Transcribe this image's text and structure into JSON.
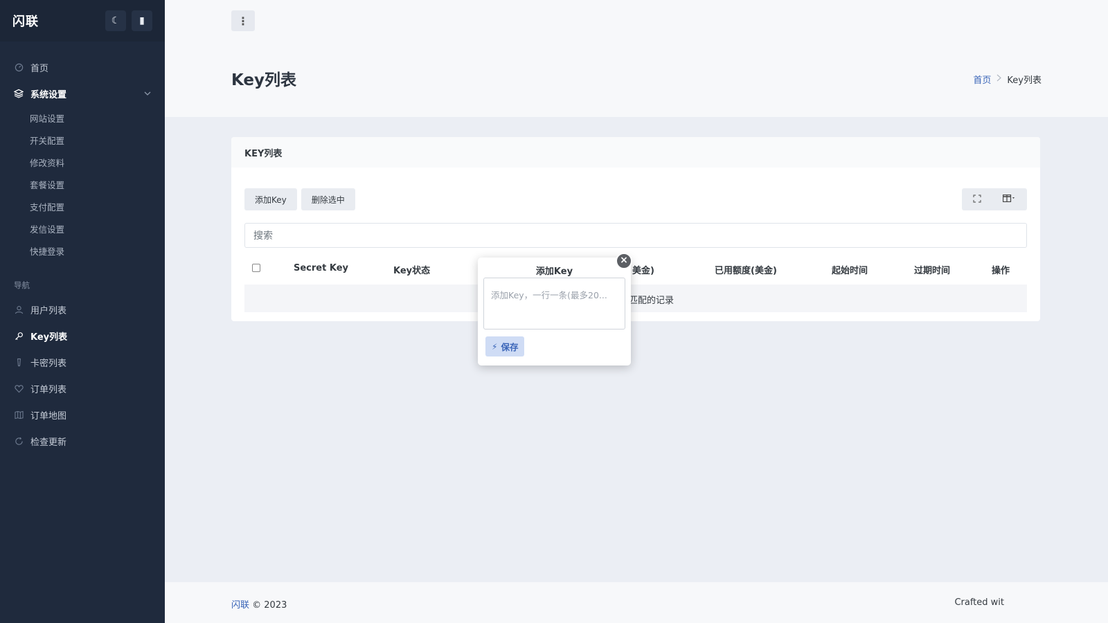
{
  "sidebar": {
    "brand": "闪联",
    "theme_icon": "moon-icon",
    "pin_icon": "pin-icon",
    "items_top": [
      {
        "label": "首页",
        "icon": "dashboard-icon"
      },
      {
        "label": "系统设置",
        "icon": "layers-icon",
        "expanded": true
      }
    ],
    "sub_items": [
      "网站设置",
      "开关配置",
      "修改资料",
      "套餐设置",
      "支付配置",
      "发信设置",
      "快捷登录"
    ],
    "section_label": "导航",
    "items_nav": [
      {
        "label": "用户列表",
        "icon": "user-icon"
      },
      {
        "label": "Key列表",
        "icon": "key-icon",
        "active": true
      },
      {
        "label": "卡密列表",
        "icon": "card-icon"
      },
      {
        "label": "订单列表",
        "icon": "heart-icon"
      },
      {
        "label": "订单地图",
        "icon": "map-icon"
      },
      {
        "label": "检查更新",
        "icon": "refresh-icon"
      }
    ]
  },
  "header": {
    "page_title": "Key列表",
    "breadcrumb_home": "首页",
    "breadcrumb_current": "Key列表"
  },
  "card": {
    "title": "KEY列表",
    "add_button": "添加Key",
    "delete_button": "删除选中",
    "search_placeholder": "搜索",
    "columns": [
      "Secret Key",
      "Key状态",
      "美金)",
      "已用额度(美金)",
      "起始时间",
      "过期时间",
      "操作"
    ],
    "empty_text": "匹配的记录"
  },
  "modal": {
    "title": "添加Key",
    "textarea_placeholder": "添加Key，一行一条(最多20...",
    "save_button": "保存"
  },
  "footer": {
    "brand": "闪联",
    "copyright": "© 2023",
    "crafted": "Crafted wit"
  },
  "colors": {
    "sidebar_bg": "#1f2a3d",
    "accent": "#3a65b8",
    "page_bg": "#ebeef4"
  }
}
